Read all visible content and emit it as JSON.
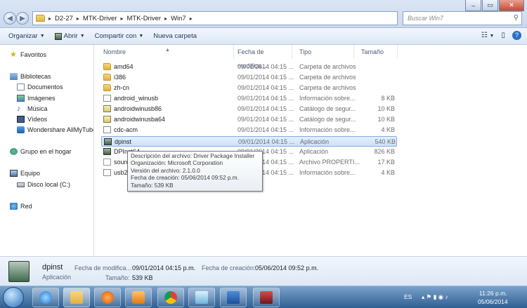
{
  "address": {
    "crumbs": [
      "D2-27",
      "MTK-Driver",
      "MTK-Driver",
      "Win7"
    ],
    "search_placeholder": "Buscar Win7"
  },
  "toolbar": {
    "organize": "Organizar",
    "open": "Abrir",
    "share": "Compartir con",
    "new_folder": "Nueva carpeta"
  },
  "nav": {
    "favorites": "Favoritos",
    "libraries": "Bibliotecas",
    "documents": "Documentos",
    "images": "Imágenes",
    "music": "Música",
    "videos": "Vídeos",
    "wondershare": "Wondershare AllMyTube",
    "homegroup": "Grupo en el hogar",
    "computer": "Equipo",
    "local_disk": "Disco local (C:)",
    "network": "Red"
  },
  "columns": {
    "name": "Nombre",
    "date": "Fecha de modifica...",
    "type": "Tipo",
    "size": "Tamaño"
  },
  "files": [
    {
      "name": "amd64",
      "date": "09/01/2014 04:15 ...",
      "type": "Carpeta de archivos",
      "size": "",
      "icon": "folder"
    },
    {
      "name": "i386",
      "date": "09/01/2014 04:15 ...",
      "type": "Carpeta de archivos",
      "size": "",
      "icon": "folder"
    },
    {
      "name": "zh-cn",
      "date": "09/01/2014 04:15 ...",
      "type": "Carpeta de archivos",
      "size": "",
      "icon": "folder"
    },
    {
      "name": "android_winusb",
      "date": "09/01/2014 04:15 ...",
      "type": "Información sobre...",
      "size": "8 KB",
      "icon": "inf"
    },
    {
      "name": "androidwinusb86",
      "date": "09/01/2014 04:15 ...",
      "type": "Catálogo de segur...",
      "size": "10 KB",
      "icon": "cat"
    },
    {
      "name": "androidwinusba64",
      "date": "09/01/2014 04:15 ...",
      "type": "Catálogo de segur...",
      "size": "10 KB",
      "icon": "cat"
    },
    {
      "name": "cdc-acm",
      "date": "09/01/2014 04:15 ...",
      "type": "Información sobre...",
      "size": "4 KB",
      "icon": "inf"
    },
    {
      "name": "dpinst",
      "date": "09/01/2014 04:15 ...",
      "type": "Aplicación",
      "size": "540 KB",
      "icon": "exe"
    },
    {
      "name": "DPInst64",
      "date": "09/01/2014 04:15 ...",
      "type": "Aplicación",
      "size": "826 KB",
      "icon": "exe"
    },
    {
      "name": "source",
      "date": "09/01/2014 04:15 ...",
      "type": "Archivo PROPERTI...",
      "size": "17 KB",
      "icon": "prop"
    },
    {
      "name": "usb2ser",
      "date": "09/01/2014 04:15 ...",
      "type": "Información sobre...",
      "size": "4 KB",
      "icon": "inf"
    }
  ],
  "tooltip": {
    "line1": "Descripción del archivo: Driver Package Installer",
    "line2": "Organización: Microsoft Corporation",
    "line3": "Versión del archivo: 2.1.0.0",
    "line4": "Fecha de creación: 05/06/2014 09:52 p.m.",
    "line5": "Tamaño: 539 KB"
  },
  "details": {
    "name": "dpinst",
    "kind": "Aplicación",
    "modified_label": "Fecha de modifica...",
    "modified_value": "09/01/2014 04:15 p.m.",
    "size_label": "Tamaño:",
    "size_value": "539 KB",
    "created_label": "Fecha de creación:",
    "created_value": "05/06/2014 09:52 p.m."
  },
  "tray": {
    "lang": "ES",
    "time": "11:26 p.m.",
    "date": "05/06/2014"
  }
}
